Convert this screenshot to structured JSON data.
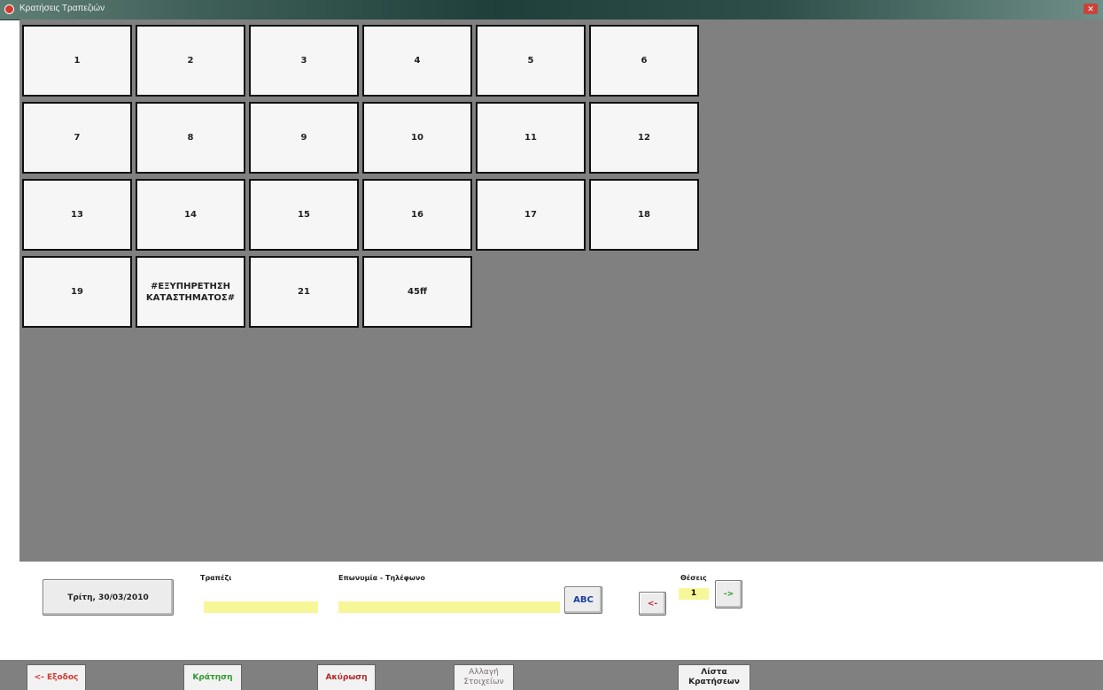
{
  "window": {
    "title": "Κρατήσεις Τραπεζιών",
    "close_glyph": "✕"
  },
  "tables": [
    {
      "label": "1"
    },
    {
      "label": "2"
    },
    {
      "label": "3"
    },
    {
      "label": "4"
    },
    {
      "label": "5"
    },
    {
      "label": "6"
    },
    {
      "label": "7"
    },
    {
      "label": "8"
    },
    {
      "label": "9"
    },
    {
      "label": "10"
    },
    {
      "label": "11"
    },
    {
      "label": "12"
    },
    {
      "label": "13"
    },
    {
      "label": "14"
    },
    {
      "label": "15"
    },
    {
      "label": "16"
    },
    {
      "label": "17"
    },
    {
      "label": "18"
    },
    {
      "label": "19"
    },
    {
      "label": "#ΕΞΥΠΗΡΕΤΗΣΗ ΚΑΤΑΣΤΗΜΑΤΟΣ#"
    },
    {
      "label": "21"
    },
    {
      "label": "45ff"
    }
  ],
  "bottom": {
    "date": "Τρίτη, 30/03/2010",
    "table_label": "Τραπέζι",
    "table_value": "",
    "name_phone_label": "Επωνυμία - Τηλέφωνο",
    "name_phone_value": "",
    "abc_button": "ABC",
    "prev_arrow": "<-",
    "next_arrow": "->",
    "seats_label": "Θέσεις",
    "seats_value": "1"
  },
  "footer": {
    "exit": "<- Εξοδος",
    "reserve": "Κράτηση",
    "cancel": "Ακύρωση",
    "change_data": "Αλλαγή Στοιχείων",
    "list": "Λίστα Κρατήσεων"
  },
  "colors": {
    "exit": "#d23a2e",
    "reserve": "#2e9a2e",
    "cancel": "#b02a2a",
    "change_data": "#7a6e6e",
    "list": "#222222",
    "abc": "#1b3fa0",
    "prev_arrow": "#c02020",
    "next_arrow": "#1e9a1e"
  }
}
